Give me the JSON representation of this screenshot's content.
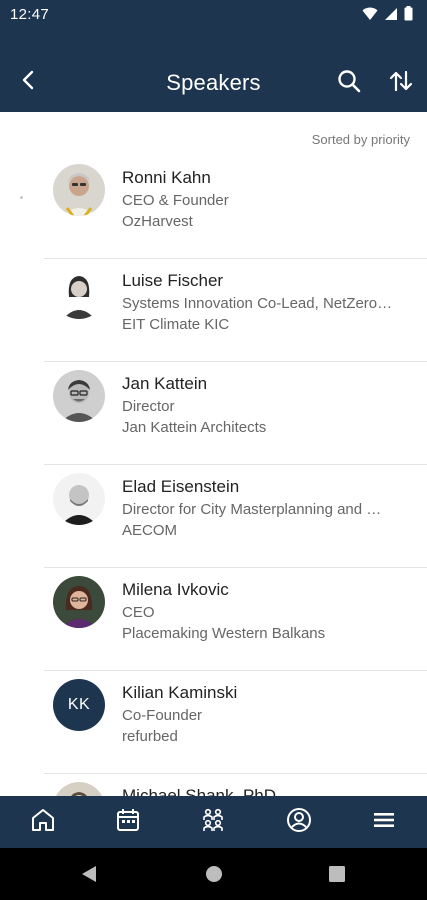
{
  "status_bar": {
    "time": "12:47",
    "icons": [
      "wifi-icon",
      "signal-icon",
      "battery-icon"
    ]
  },
  "app_bar": {
    "title": "Speakers",
    "icons": [
      "back-arrow-icon",
      "search-icon",
      "sort-icon"
    ]
  },
  "list_header": {
    "sort_label": "Sorted by priority"
  },
  "speakers": [
    {
      "name": "Ronni Kahn",
      "role": "CEO & Founder",
      "org": "OzHarvest",
      "avatar": "photo"
    },
    {
      "name": "Luise Fischer",
      "role": "Systems Innovation Co-Lead, NetZero…",
      "org": "EIT Climate KIC",
      "avatar": "photo"
    },
    {
      "name": "Jan Kattein",
      "role": "Director",
      "org": "Jan Kattein Architects",
      "avatar": "photo"
    },
    {
      "name": "Elad Eisenstein",
      "role": "Director for City Masterplanning and …",
      "org": "AECOM",
      "avatar": "photo"
    },
    {
      "name": "Milena Ivkovic",
      "role": "CEO",
      "org": "Placemaking Western Balkans",
      "avatar": "photo"
    },
    {
      "name": "Kilian Kaminski",
      "role": "Co-Founder",
      "org": "refurbed",
      "avatar": "initials",
      "initials": "KK"
    },
    {
      "name": "Michael Shank, PhD",
      "role": "",
      "org": "",
      "avatar": "photo"
    }
  ],
  "bottom_nav": [
    {
      "id": "home",
      "icon": "home-icon"
    },
    {
      "id": "schedule",
      "icon": "calendar-icon"
    },
    {
      "id": "people",
      "icon": "people-icon"
    },
    {
      "id": "profile",
      "icon": "profile-icon"
    },
    {
      "id": "menu",
      "icon": "menu-icon"
    }
  ],
  "colors": {
    "primary": "#1e3550",
    "background": "#ffffff",
    "text_primary": "#222222",
    "text_secondary": "#666666"
  }
}
